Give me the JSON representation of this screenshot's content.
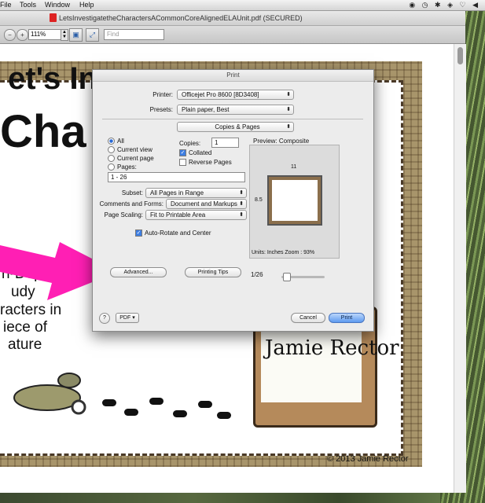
{
  "menubar": {
    "items": [
      "File",
      "Tools",
      "Window",
      "Help"
    ]
  },
  "window": {
    "title": "LetsInvestigatetheCharactersACommonCoreAlignedELAUnit.pdf (SECURED)",
    "zoom": "111%",
    "find_placeholder": "Find"
  },
  "document": {
    "line1": "et's In",
    "line2": "Cha",
    "desc": [
      "n-Depth",
      "udy",
      "racters in",
      "iece of",
      "ature"
    ],
    "author": "Jamie Rector",
    "copyright": "© 2013 Jamie Rector"
  },
  "dialog": {
    "title": "Print",
    "printer_label": "Printer:",
    "printer": "Officejet Pro 8600 [8D3408]",
    "presets_label": "Presets:",
    "presets": "Plain paper, Best",
    "section": "Copies & Pages",
    "range_all": "All",
    "range_current_view": "Current view",
    "range_current_page": "Current page",
    "range_pages": "Pages:",
    "pages_value": "1 - 26",
    "copies_label": "Copies:",
    "copies_value": "1",
    "collated": "Collated",
    "reverse_pages": "Reverse Pages",
    "subset_label": "Subset:",
    "subset": "All Pages in Range",
    "comments_label": "Comments and Forms:",
    "comments": "Document and Markups",
    "scaling_label": "Page Scaling:",
    "scaling": "Fit to Printable Area",
    "auto_rotate": "Auto-Rotate and Center",
    "advanced": "Advanced...",
    "printing_tips": "Printing Tips",
    "preview_label": "Preview: Composite",
    "preview_width": "11",
    "preview_height": "8.5",
    "units": "Units: Inches Zoom :  93%",
    "page_counter": "1/26",
    "help": "?",
    "pdf": "PDF",
    "cancel": "Cancel",
    "print": "Print"
  },
  "colors": {
    "accent": "#3d7ee2",
    "arrow": "#ff1fb4"
  }
}
